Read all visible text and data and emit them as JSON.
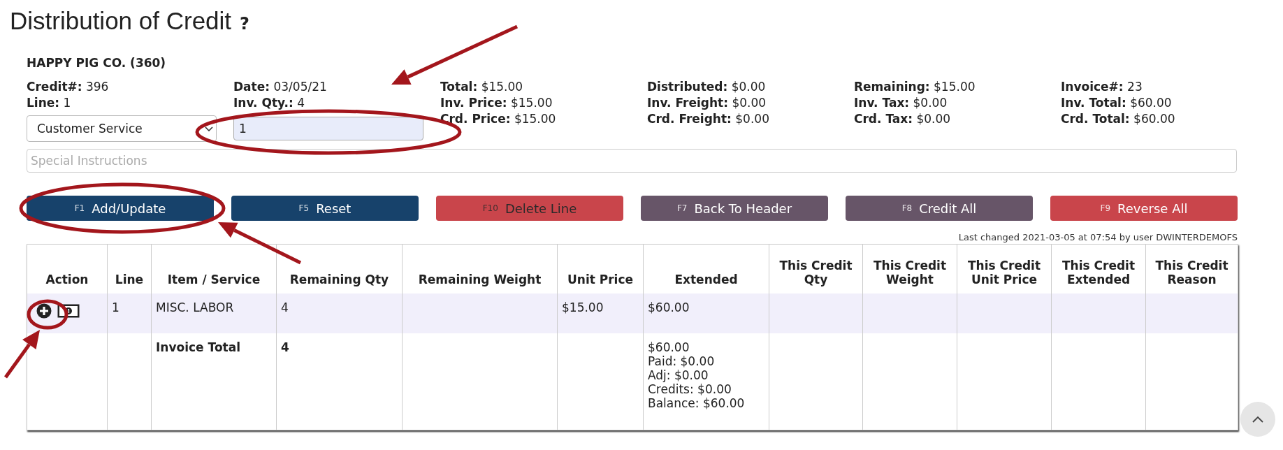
{
  "title": "Distribution of Credit",
  "help_mark": "?",
  "customer": "HAPPY PIG CO. (360)",
  "info_columns": [
    {
      "fields": [
        {
          "label": "Credit#:",
          "value": "396"
        },
        {
          "label": "Line:",
          "value": "1"
        }
      ],
      "control": {
        "kind": "select",
        "value": "Customer Service"
      }
    },
    {
      "fields": [
        {
          "label": "Date:",
          "value": "03/05/21"
        },
        {
          "label": "Inv. Qty.:",
          "value": "4"
        }
      ],
      "control": {
        "kind": "input",
        "value": "1"
      }
    },
    {
      "fields": [
        {
          "label": "Total:",
          "value": "$15.00"
        },
        {
          "label": "Inv. Price:",
          "value": "$15.00"
        },
        {
          "label": "Crd. Price:",
          "value": "$15.00"
        }
      ]
    },
    {
      "fields": [
        {
          "label": "Distributed:",
          "value": "$0.00"
        },
        {
          "label": "Inv. Freight:",
          "value": "$0.00"
        },
        {
          "label": "Crd. Freight:",
          "value": "$0.00"
        }
      ]
    },
    {
      "fields": [
        {
          "label": "Remaining:",
          "value": "$15.00"
        },
        {
          "label": "Inv. Tax:",
          "value": "$0.00"
        },
        {
          "label": "Crd. Tax:",
          "value": "$0.00"
        }
      ]
    },
    {
      "fields": [
        {
          "label": "Invoice#:",
          "value": "23"
        },
        {
          "label": "Inv. Total:",
          "value": "$60.00"
        },
        {
          "label": "Crd. Total:",
          "value": "$60.00"
        }
      ]
    }
  ],
  "special_instructions": {
    "placeholder": "Special Instructions"
  },
  "buttons": [
    {
      "key": "F1",
      "label": "Add/Update",
      "kind": "primary",
      "disabled": false
    },
    {
      "key": "F5",
      "label": "Reset",
      "kind": "primary",
      "disabled": false
    },
    {
      "key": "F10",
      "label": "Delete Line",
      "kind": "danger",
      "disabled": true
    },
    {
      "key": "F7",
      "label": "Back To Header",
      "kind": "secondary",
      "disabled": false
    },
    {
      "key": "F8",
      "label": "Credit All",
      "kind": "secondary",
      "disabled": false
    },
    {
      "key": "F9",
      "label": "Reverse All",
      "kind": "danger",
      "disabled": false
    }
  ],
  "last_changed": "Last changed 2021-03-05 at 07:54 by user DWINTERDEMOFS",
  "table": {
    "columns": [
      "Action",
      "Line",
      "Item / Service",
      "Remaining Qty",
      "Remaining Weight",
      "Unit Price",
      "Extended",
      "This Credit Qty",
      "This Credit Weight",
      "This Credit Unit Price",
      "This Credit Extended",
      "This Credit Reason"
    ],
    "rows": [
      {
        "kind": "item",
        "cells": [
          "",
          "1",
          "MISC. LABOR",
          "4",
          "",
          "$15.00",
          "$60.00",
          "",
          "",
          "",
          "",
          ""
        ]
      },
      {
        "kind": "total",
        "cells": [
          "",
          "",
          {
            "text": "Invoice Total",
            "bold": true
          },
          {
            "text": "4",
            "bold": true
          },
          "",
          "",
          {
            "lines": [
              "$60.00",
              "Paid: $0.00",
              "Adj: $0.00",
              "Credits: $0.00",
              "Balance: $60.00"
            ]
          },
          "",
          "",
          "",
          "",
          ""
        ]
      }
    ]
  }
}
